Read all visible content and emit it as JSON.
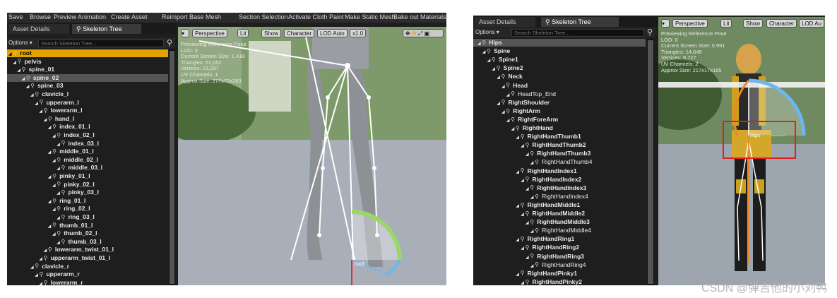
{
  "left": {
    "menubar": {
      "items": [
        "Save",
        "Browse",
        "Preview Animation",
        "Create Asset",
        "Reimport Base Mesh",
        "Section Selection",
        "Activate Cloth Paint",
        "Make Static Mesh",
        "Bake out Materials"
      ]
    },
    "tabs": {
      "asset_details": "Asset Details",
      "skeleton_tree": "Skeleton Tree"
    },
    "options_label": "Options ▾",
    "search_placeholder": "Search Skeleton Tree...",
    "tree": [
      {
        "label": "root",
        "indent": 0,
        "bold": true,
        "state": "selected"
      },
      {
        "label": "pelvis",
        "indent": 1,
        "bold": true
      },
      {
        "label": "spine_01",
        "indent": 2,
        "bold": true
      },
      {
        "label": "spine_02",
        "indent": 3,
        "bold": true,
        "state": "highlight"
      },
      {
        "label": "spine_03",
        "indent": 4,
        "bold": true
      },
      {
        "label": "clavicle_l",
        "indent": 5,
        "bold": true
      },
      {
        "label": "upperarm_l",
        "indent": 6,
        "bold": true
      },
      {
        "label": "lowerarm_l",
        "indent": 7,
        "bold": true
      },
      {
        "label": "hand_l",
        "indent": 8,
        "bold": true
      },
      {
        "label": "index_01_l",
        "indent": 9,
        "bold": true
      },
      {
        "label": "index_02_l",
        "indent": 10,
        "bold": true
      },
      {
        "label": "index_03_l",
        "indent": 11,
        "bold": true
      },
      {
        "label": "middle_01_l",
        "indent": 9,
        "bold": true
      },
      {
        "label": "middle_02_l",
        "indent": 10,
        "bold": true
      },
      {
        "label": "middle_03_l",
        "indent": 11,
        "bold": true
      },
      {
        "label": "pinky_01_l",
        "indent": 9,
        "bold": true
      },
      {
        "label": "pinky_02_l",
        "indent": 10,
        "bold": true
      },
      {
        "label": "pinky_03_l",
        "indent": 11,
        "bold": true
      },
      {
        "label": "ring_01_l",
        "indent": 9,
        "bold": true
      },
      {
        "label": "ring_02_l",
        "indent": 10,
        "bold": true
      },
      {
        "label": "ring_03_l",
        "indent": 11,
        "bold": true
      },
      {
        "label": "thumb_01_l",
        "indent": 9,
        "bold": true
      },
      {
        "label": "thumb_02_l",
        "indent": 10,
        "bold": true
      },
      {
        "label": "thumb_03_l",
        "indent": 11,
        "bold": true
      },
      {
        "label": "lowerarm_twist_01_l",
        "indent": 8,
        "bold": true
      },
      {
        "label": "upperarm_twist_01_l",
        "indent": 7,
        "bold": true
      },
      {
        "label": "clavicle_r",
        "indent": 5,
        "bold": true
      },
      {
        "label": "upperarm_r",
        "indent": 6,
        "bold": true
      },
      {
        "label": "lowerarm_r",
        "indent": 7,
        "bold": true
      }
    ],
    "viewport": {
      "buttons": {
        "perspective": "Perspective",
        "lit": "Lit",
        "show": "Show",
        "character": "Character",
        "lod": "LOD Auto",
        "speed": "x1.0"
      },
      "info": [
        "Previewing Reference Pose",
        "LOD: 0",
        "Current Screen Size: 1.418",
        "Triangles: 51,052",
        "Vertices: 23,297",
        "UV Channels: 1",
        "Approx Size: 277x73x283"
      ],
      "bone_label": "root"
    }
  },
  "right": {
    "tabs": {
      "asset_details": "Asset Details",
      "skeleton_tree": "Skeleton Tree"
    },
    "options_label": "Options ▾",
    "search_placeholder": "Search Skeleton Tree...",
    "tree": [
      {
        "label": "Hips",
        "indent": 0,
        "bold": true,
        "state": "highlight"
      },
      {
        "label": "Spine",
        "indent": 1,
        "bold": true
      },
      {
        "label": "Spine1",
        "indent": 2,
        "bold": true
      },
      {
        "label": "Spine2",
        "indent": 3,
        "bold": true
      },
      {
        "label": "Neck",
        "indent": 4,
        "bold": true
      },
      {
        "label": "Head",
        "indent": 5,
        "bold": true
      },
      {
        "label": "HeadTop_End",
        "indent": 6,
        "bold": false
      },
      {
        "label": "RightShoulder",
        "indent": 4,
        "bold": true
      },
      {
        "label": "RightArm",
        "indent": 5,
        "bold": true
      },
      {
        "label": "RightForeArm",
        "indent": 6,
        "bold": true
      },
      {
        "label": "RightHand",
        "indent": 7,
        "bold": true
      },
      {
        "label": "RightHandThumb1",
        "indent": 8,
        "bold": true
      },
      {
        "label": "RightHandThumb2",
        "indent": 9,
        "bold": true
      },
      {
        "label": "RightHandThumb3",
        "indent": 10,
        "bold": true
      },
      {
        "label": "RightHandThumb4",
        "indent": 11,
        "bold": false
      },
      {
        "label": "RightHandIndex1",
        "indent": 8,
        "bold": true
      },
      {
        "label": "RightHandIndex2",
        "indent": 9,
        "bold": true
      },
      {
        "label": "RightHandIndex3",
        "indent": 10,
        "bold": true
      },
      {
        "label": "RightHandIndex4",
        "indent": 11,
        "bold": false
      },
      {
        "label": "RightHandMiddle1",
        "indent": 8,
        "bold": true
      },
      {
        "label": "RightHandMiddle2",
        "indent": 9,
        "bold": true
      },
      {
        "label": "RightHandMiddle3",
        "indent": 10,
        "bold": true
      },
      {
        "label": "RightHandMiddle4",
        "indent": 11,
        "bold": false
      },
      {
        "label": "RightHandRing1",
        "indent": 8,
        "bold": true
      },
      {
        "label": "RightHandRing2",
        "indent": 9,
        "bold": true
      },
      {
        "label": "RightHandRing3",
        "indent": 10,
        "bold": true
      },
      {
        "label": "RightHandRing4",
        "indent": 11,
        "bold": false
      },
      {
        "label": "RightHandPinky1",
        "indent": 8,
        "bold": true
      },
      {
        "label": "RightHandPinky2",
        "indent": 9,
        "bold": true
      }
    ],
    "viewport": {
      "buttons": {
        "perspective": "Perspective",
        "lit": "Lit",
        "show": "Show",
        "character": "Character",
        "lod": "LOD Au"
      },
      "info": [
        "Previewing Reference Pose",
        "LOD: 0",
        "Current Screen Size: 0.951",
        "Triangles: 14,646",
        "Vertices: 9,727",
        "UV Channels: 2",
        "Approx Size: 217x17x185"
      ],
      "bone_label": "Hips"
    }
  },
  "watermark": "CSDN @弹吉他的小刘鸭",
  "colors": {
    "selected": "#e2a300",
    "panel": "#1e1e1e",
    "highlight_box": "#e02020"
  }
}
